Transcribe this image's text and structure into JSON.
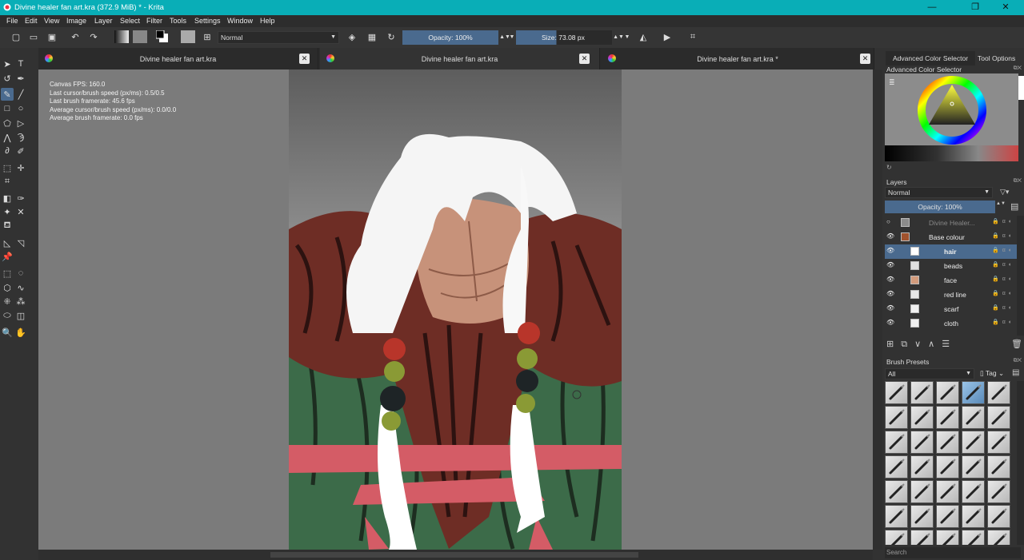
{
  "window": {
    "title": "Divine healer fan art.kra (372.9 MiB)  * - Krita",
    "controls": [
      "—",
      "❐",
      "✕"
    ]
  },
  "menu": [
    "File",
    "Edit",
    "View",
    "Image",
    "Layer",
    "Select",
    "Filter",
    "Tools",
    "Settings",
    "Window",
    "Help"
  ],
  "toolbar": {
    "blend_mode": "Normal",
    "opacity": "Opacity: 100%",
    "size": "Size: 73.08 px"
  },
  "tabs": [
    {
      "label": "Divine healer fan art.kra"
    },
    {
      "label": "Divine healer fan art.kra"
    },
    {
      "label": "Divine healer fan art.kra *"
    }
  ],
  "overlay": {
    "lines": [
      "Canvas FPS: 160.0",
      "Last cursor/brush speed (px/ms): 0.5/0.5",
      "Last brush framerate: 45.6 fps",
      "Average cursor/brush speed (px/ms): 0.0/0.0",
      "Average brush framerate: 0.0 fps"
    ]
  },
  "dock": {
    "tabs": [
      "Advanced Color Selector",
      "Tool Options"
    ],
    "color_selector_title": "Advanced Color Selector",
    "layers_title": "Layers",
    "layers_blend": "Normal",
    "layers_opacity": "Opacity:  100%",
    "layers": [
      {
        "name": "Divine Healer...",
        "visible": false,
        "selected": false,
        "indent": 0,
        "thumb": "#8c8c8c"
      },
      {
        "name": "Base colour",
        "visible": true,
        "selected": false,
        "indent": 0,
        "thumb": "#a0522d"
      },
      {
        "name": "hair",
        "visible": true,
        "selected": true,
        "indent": 1,
        "thumb": "#ffffff"
      },
      {
        "name": "beads",
        "visible": true,
        "selected": false,
        "indent": 1,
        "thumb": "#e0e0e0"
      },
      {
        "name": "face",
        "visible": true,
        "selected": false,
        "indent": 1,
        "thumb": "#d29b7c"
      },
      {
        "name": "red line",
        "visible": true,
        "selected": false,
        "indent": 1,
        "thumb": "#e8e8e8"
      },
      {
        "name": "scarf",
        "visible": true,
        "selected": false,
        "indent": 1,
        "thumb": "#f0f0f0"
      },
      {
        "name": "cloth",
        "visible": true,
        "selected": false,
        "indent": 1,
        "thumb": "#f0f0f0"
      }
    ],
    "brush_presets_title": "Brush Presets",
    "brush_filter": "All",
    "tag_label": "Tag",
    "search_placeholder": "Search"
  }
}
